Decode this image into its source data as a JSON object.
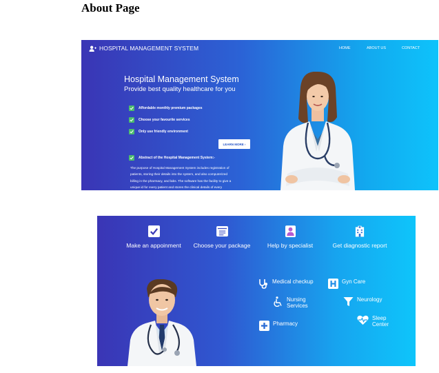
{
  "page": {
    "heading": "About Page"
  },
  "banner1": {
    "brand": "HOSPITAL MANAGEMENT SYSTEM",
    "nav": [
      "HOME",
      "ABOUT US",
      "CONTACT"
    ],
    "hero_title": "Hospital Management System",
    "hero_subtitle": "Provide best quality healthcare for you",
    "checks": [
      "Affordable monthly premium packages",
      "Choose your favourite services",
      "Only use friendly environment"
    ],
    "learn_more": "LEARN MORE ›",
    "abstract_title": "Abstract of the Hospital Management System:-",
    "abstract_lines": [
      "The purpose of Hospital Management System includes registration of",
      "patients, storing their details into the system, and also computerized",
      "billing in the pharmacy, and labs. The software has the facility to give a",
      "unique id for every patient and stores the clinical details of every"
    ]
  },
  "banner2": {
    "features": [
      {
        "label": "Make an appoinment",
        "icon": "checkbox-icon"
      },
      {
        "label": "Choose your package",
        "icon": "list-window-icon"
      },
      {
        "label": "Help by specialist",
        "icon": "doctor-badge-icon"
      },
      {
        "label": "Get diagnostic report",
        "icon": "hospital-building-icon"
      }
    ],
    "services": {
      "medical_checkup": "Medical checkup",
      "gyn_care": "Gyn Care",
      "nursing_1": "Nursing",
      "nursing_2": "Services",
      "neurology": "Neurology",
      "pharmacy": "Pharmacy",
      "sleep_1": "Sleep",
      "sleep_2": "Center"
    }
  },
  "colors": {
    "gradient_start": "#3a35b5",
    "gradient_end": "#0ec3fb",
    "check_green": "#4cbb6e"
  }
}
